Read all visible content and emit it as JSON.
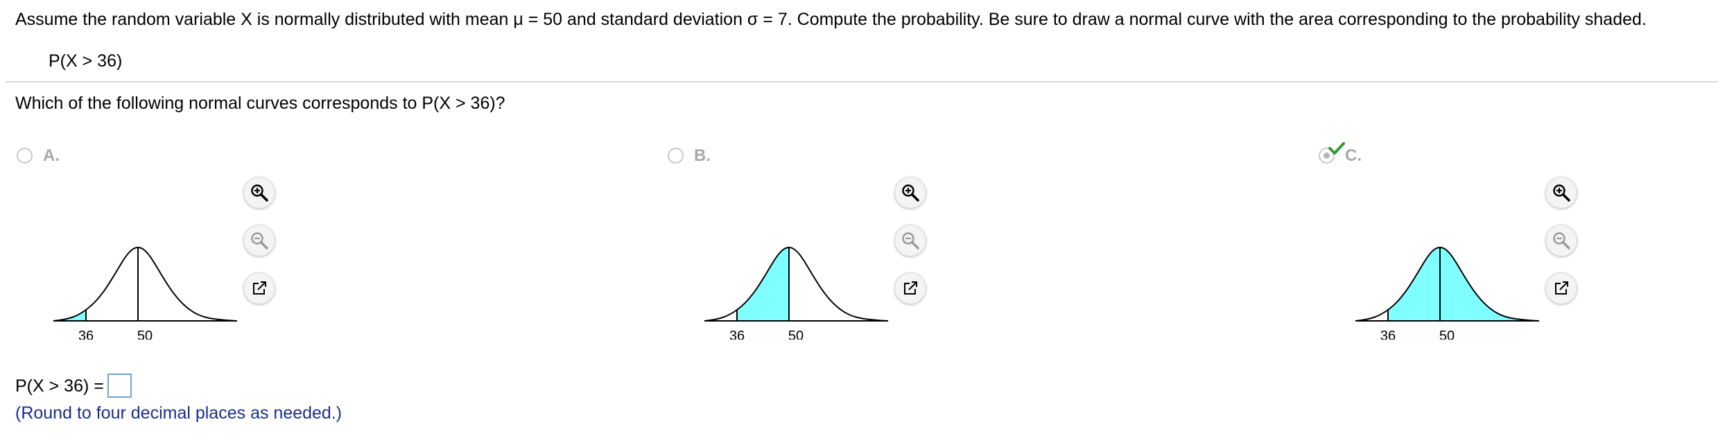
{
  "intro": "Assume the random variable X is normally distributed with mean μ = 50 and standard deviation σ = 7. Compute the probability. Be sure to draw a normal curve with the area corresponding to the probability shaded.",
  "expression": "P(X > 36)",
  "question": "Which of the following normal curves corresponds to P(X > 36)?",
  "options": [
    {
      "letter": "A.",
      "tick_left": "36",
      "tick_mean": "50",
      "shading": "left tail (X < 36)",
      "selected": false
    },
    {
      "letter": "B.",
      "tick_left": "36",
      "tick_mean": "50",
      "shading": "36 to 50",
      "selected": false
    },
    {
      "letter": "C.",
      "tick_left": "36",
      "tick_mean": "50",
      "shading": "right of 36 (X > 36)",
      "selected": true
    }
  ],
  "tools": {
    "zoom_in": "zoom-in-icon",
    "zoom_out": "zoom-out-icon",
    "popout": "popout-icon"
  },
  "answer": {
    "label": "P(X > 36) =",
    "value": ""
  },
  "hint": "(Round to four decimal places as needed.)",
  "colors": {
    "shade": "#7fffff",
    "hint": "#1c2d8c",
    "check": "#2e9c2e",
    "input_border": "#6ba4d6"
  }
}
